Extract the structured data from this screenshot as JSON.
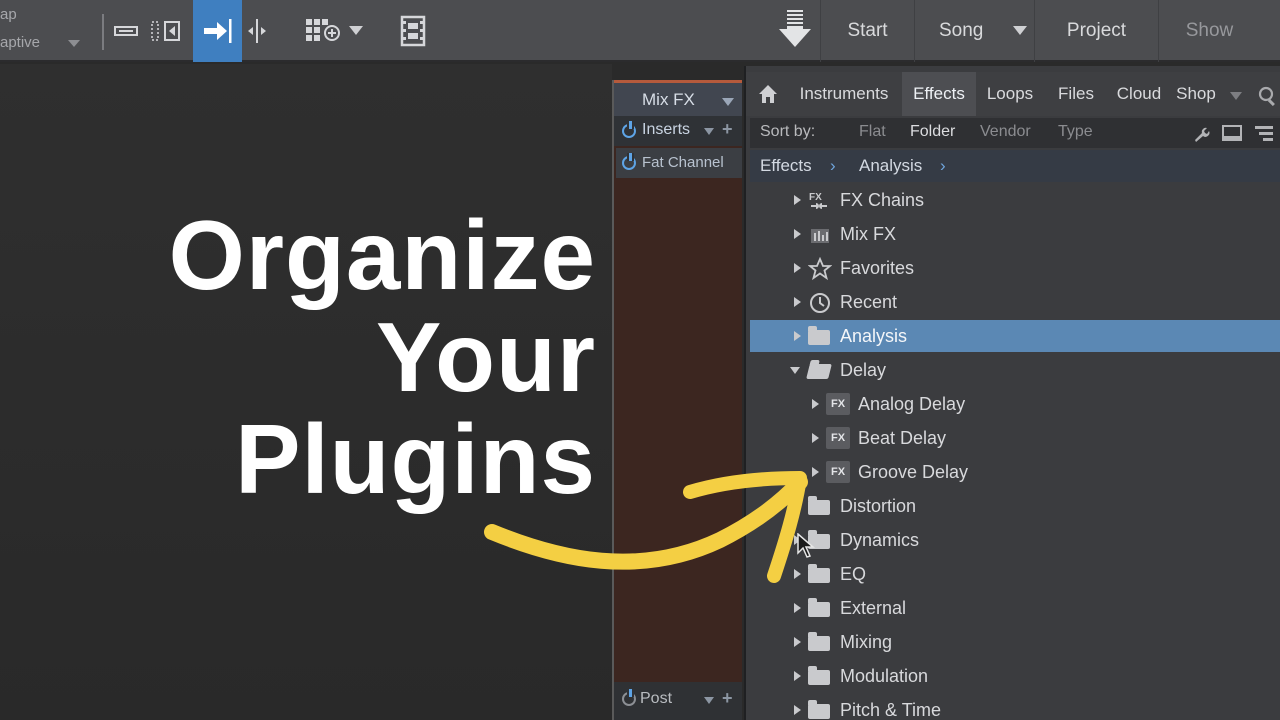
{
  "toolbar": {
    "left_top": "ap",
    "left_select": "aptive",
    "nav": {
      "start": "Start",
      "song": "Song",
      "project": "Project",
      "show": "Show"
    },
    "accent_color": "#3f7fc0"
  },
  "headline": {
    "line1": "Organize",
    "line2": "Your",
    "line3": "Plugins"
  },
  "strip": {
    "title": "Mix FX",
    "inserts_label": "Inserts",
    "slot1": "Fat Channel",
    "post_label": "Post"
  },
  "browser": {
    "tabs": [
      "Instruments",
      "Effects",
      "Loops",
      "Files",
      "Cloud",
      "Shop"
    ],
    "active_tab": "Effects",
    "sort": {
      "label": "Sort by:",
      "options": [
        "Flat",
        "Folder",
        "Vendor",
        "Type"
      ],
      "active": "Folder"
    },
    "breadcrumb": [
      "Effects",
      "Analysis"
    ],
    "tree": [
      {
        "label": "FX Chains",
        "icon": "fx-chains-icon"
      },
      {
        "label": "Mix FX",
        "icon": "mix-fx-icon"
      },
      {
        "label": "Favorites",
        "icon": "star-icon"
      },
      {
        "label": "Recent",
        "icon": "clock-icon"
      },
      {
        "label": "Analysis",
        "icon": "folder-icon",
        "selected": true
      },
      {
        "label": "Delay",
        "icon": "folder-open-icon",
        "expanded": true
      },
      {
        "label": "Analog Delay",
        "icon": "fx-plugin-icon",
        "badge": "FX"
      },
      {
        "label": "Beat Delay",
        "icon": "fx-plugin-icon",
        "badge": "FX"
      },
      {
        "label": "Groove Delay",
        "icon": "fx-plugin-icon",
        "badge": "FX"
      },
      {
        "label": "Distortion",
        "icon": "folder-icon"
      },
      {
        "label": "Dynamics",
        "icon": "folder-icon"
      },
      {
        "label": "EQ",
        "icon": "folder-icon"
      },
      {
        "label": "External",
        "icon": "folder-icon"
      },
      {
        "label": "Mixing",
        "icon": "folder-icon"
      },
      {
        "label": "Modulation",
        "icon": "folder-icon"
      },
      {
        "label": "Pitch & Time",
        "icon": "folder-icon"
      }
    ],
    "selection_color": "#5b88b4"
  },
  "annotation": {
    "arrow_color": "#f4cf43"
  }
}
